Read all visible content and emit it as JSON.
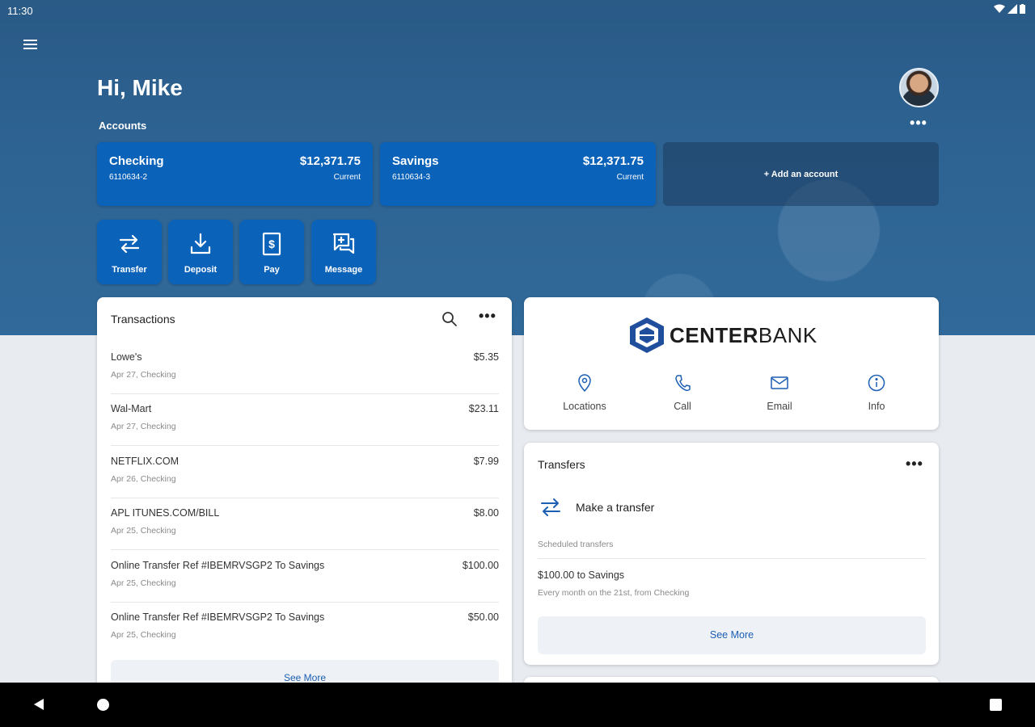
{
  "status": {
    "time": "11:30"
  },
  "header": {
    "greeting": "Hi, Mike"
  },
  "accounts": {
    "label": "Accounts",
    "items": [
      {
        "name": "Checking",
        "number": "6110634-2",
        "balance": "$12,371.75",
        "balance_label": "Current"
      },
      {
        "name": "Savings",
        "number": "6110634-3",
        "balance": "$12,371.75",
        "balance_label": "Current"
      }
    ],
    "add_label": "+ Add an account"
  },
  "actions": [
    {
      "label": "Transfer",
      "icon": "transfer-icon"
    },
    {
      "label": "Deposit",
      "icon": "deposit-icon"
    },
    {
      "label": "Pay",
      "icon": "pay-icon"
    },
    {
      "label": "Message",
      "icon": "message-icon"
    }
  ],
  "transactions": {
    "title": "Transactions",
    "rows": [
      {
        "desc": "Lowe's",
        "sub": "Apr 27, Checking",
        "amount": "$5.35"
      },
      {
        "desc": "Wal-Mart",
        "sub": "Apr 27, Checking",
        "amount": "$23.11"
      },
      {
        "desc": "NETFLIX.COM",
        "sub": "Apr 26, Checking",
        "amount": "$7.99"
      },
      {
        "desc": "APL ITUNES.COM/BILL",
        "sub": "Apr 25, Checking",
        "amount": "$8.00"
      },
      {
        "desc": "Online Transfer Ref #IBEMRVSGP2 To Savings",
        "sub": "Apr 25, Checking",
        "amount": "$100.00"
      },
      {
        "desc": "Online Transfer Ref #IBEMRVSGP2 To Savings",
        "sub": "Apr 25, Checking",
        "amount": "$50.00"
      }
    ],
    "see_more": "See More"
  },
  "bank": {
    "name_bold": "CENTER",
    "name_light": "BANK",
    "links": [
      {
        "label": "Locations",
        "icon": "location-pin-icon"
      },
      {
        "label": "Call",
        "icon": "phone-icon"
      },
      {
        "label": "Email",
        "icon": "envelope-icon"
      },
      {
        "label": "Info",
        "icon": "info-icon"
      }
    ]
  },
  "transfers": {
    "title": "Transfers",
    "make_label": "Make a transfer",
    "scheduled_label": "Scheduled transfers",
    "scheduled": [
      {
        "title": "$100.00 to Savings",
        "detail": "Every month on the 21st, from Checking"
      }
    ],
    "see_more": "See More"
  },
  "colors": {
    "accent": "#0b62b9",
    "hero": "#2d6393",
    "link": "#1c5fb3"
  }
}
